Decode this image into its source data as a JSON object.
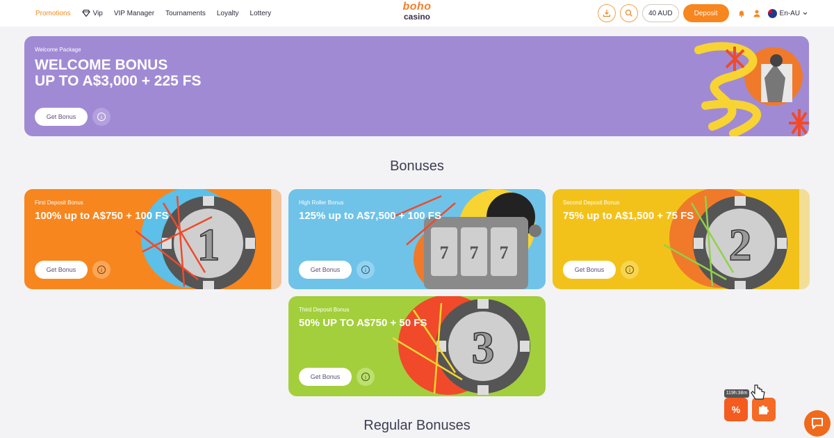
{
  "nav": {
    "items": [
      {
        "label": "Promotions",
        "active": true
      },
      {
        "label": "Vip",
        "active": false
      },
      {
        "label": "VIP Manager",
        "active": false
      },
      {
        "label": "Tournaments",
        "active": false
      },
      {
        "label": "Loyalty",
        "active": false
      },
      {
        "label": "Lottery",
        "active": false
      }
    ]
  },
  "logo": {
    "line1": "boho",
    "line2": "casino"
  },
  "header_right": {
    "balance": "40 AUD",
    "deposit_label": "Deposit",
    "language": "En-AU",
    "icons": [
      "download-icon",
      "search-icon",
      "bell-icon",
      "user-icon",
      "flag-au-icon",
      "chevron-down-icon"
    ]
  },
  "welcome": {
    "small": "Welcome Package",
    "line1": "WELCOME BONUS",
    "line2": "UP TO A$3,000 + 225 FS",
    "button": "Get Bonus",
    "info": "i",
    "bg": "#a18ad4"
  },
  "bonuses_title": "Bonuses",
  "bonus_cards": [
    {
      "small": "First Deposit Bonus",
      "big": "100% up to A$750 + 100 FS",
      "button": "Get Bonus",
      "info": "i",
      "bg": "#f7861f",
      "chip_number": "1"
    },
    {
      "small": "High Roller Bonus",
      "big": "125% up to A$7,500 + 100 FS",
      "button": "Get Bonus",
      "info": "i",
      "bg": "#6fc3e8"
    },
    {
      "small": "Second Deposit Bonus",
      "big": "75% up to A$1,500 + 75 FS",
      "button": "Get Bonus",
      "info": "i",
      "bg": "#f3c21a",
      "chip_number": "2"
    },
    {
      "small": "Third Deposit Bonus",
      "big": "50% UP TO A$750 + 50 FS",
      "button": "Get Bonus",
      "info": "i",
      "bg": "#a3cf3c",
      "chip_number": "3"
    }
  ],
  "regular_title": "Regular Bonuses",
  "floating": {
    "timer": "119h:38m",
    "icons": [
      "percent-flame-icon",
      "puzzle-icon"
    ]
  },
  "chat": {
    "icon": "chat-icon"
  },
  "colors": {
    "accent": "#f7861f",
    "nav_active": "#f28a1c"
  }
}
